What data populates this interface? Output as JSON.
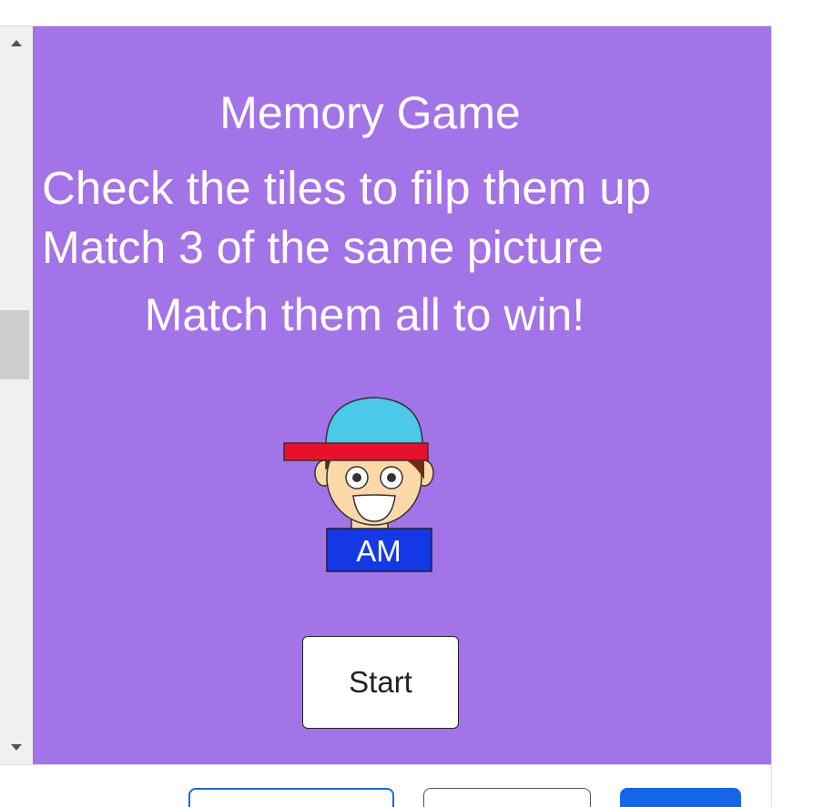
{
  "game": {
    "title": "Memory Game",
    "instruction_1": "Check the tiles to filp them up",
    "instruction_2": "Match 3 of the same picture",
    "instruction_3": "Match them all to win!",
    "avatar": {
      "badge_text": "AM"
    },
    "start_label": "Start"
  },
  "icons": {
    "scroll_up": "triangle-up-icon",
    "scroll_down": "triangle-down-icon"
  },
  "colors": {
    "background": "#a373e8",
    "text": "#ffffff",
    "cap_blue": "#4ac9e8",
    "cap_brim": "#e8112a",
    "badge_blue": "#1438e6",
    "primary_button": "#1565e8"
  }
}
